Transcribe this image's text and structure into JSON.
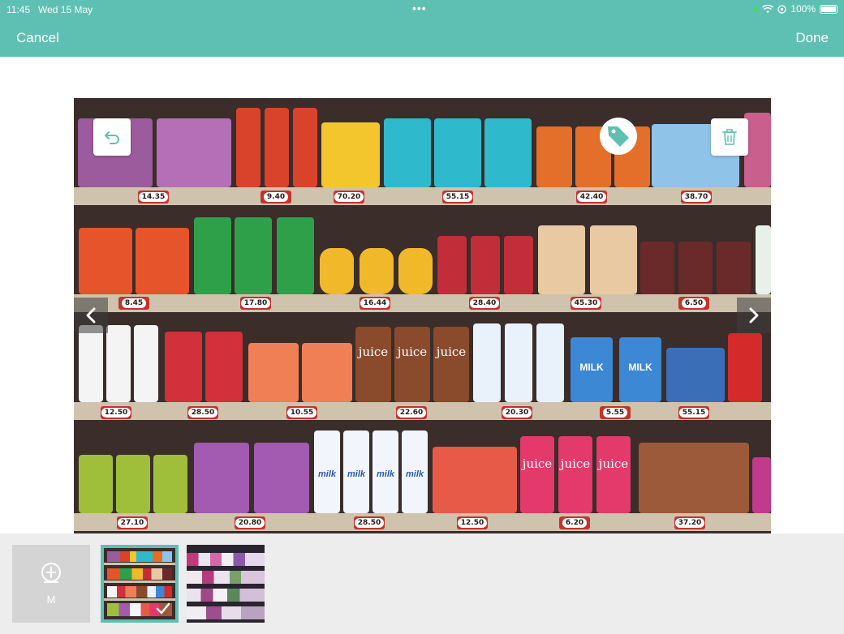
{
  "status": {
    "time": "11:45",
    "date": "Wed 15 May",
    "dots": "•••",
    "battery": "100%"
  },
  "nav": {
    "cancel": "Cancel",
    "done": "Done"
  },
  "shelves": [
    {
      "prices": [
        "14.35",
        "9.40",
        "70.20",
        "55.15",
        "42.40",
        "38.70"
      ]
    },
    {
      "prices": [
        "8.45",
        "17.80",
        "16.44",
        "28.40",
        "45.30",
        "6.50"
      ]
    },
    {
      "prices": [
        "12.50",
        "28.50",
        "10.55",
        "22.60",
        "20.30",
        "5.55",
        "55.15"
      ]
    },
    {
      "prices": [
        "27.10",
        "20.80",
        "28.50",
        "12.50",
        "6.20",
        "37.20"
      ]
    }
  ],
  "product_labels": {
    "juice": "juice",
    "milk": "MILK",
    "milk_bottle": "milk"
  },
  "thumbnails": {
    "add_label": "M"
  },
  "colors": {
    "accent": "#5dc0b3",
    "shelf_bg": "#3a2d2a",
    "tag_red": "#c4322c"
  },
  "icons": [
    "undo-icon",
    "tag-icon",
    "trash-icon",
    "chevron-left-icon",
    "chevron-right-icon",
    "checkmark-icon",
    "add-photo-icon"
  ]
}
